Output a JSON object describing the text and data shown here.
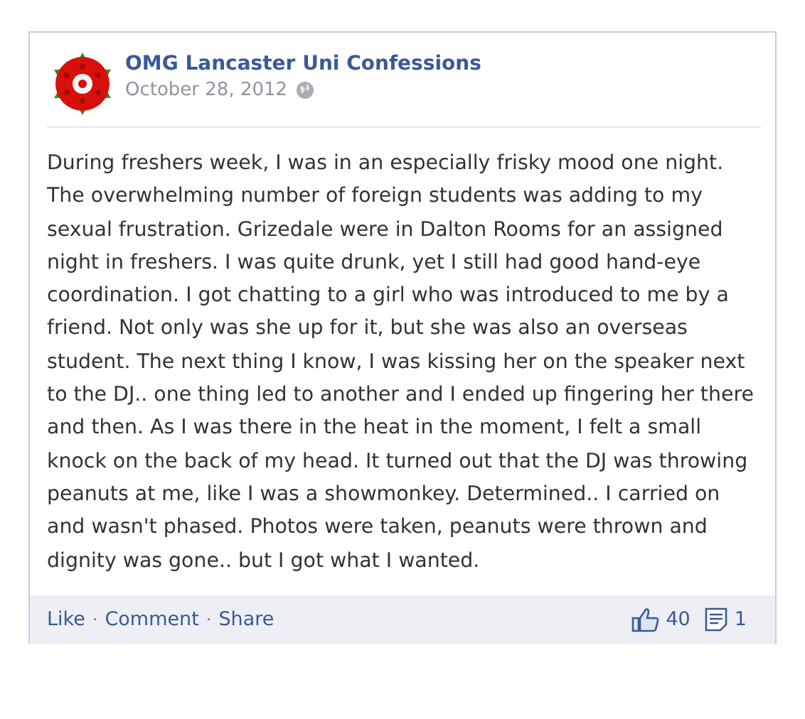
{
  "post": {
    "author": "OMG Lancaster Uni Confessions",
    "date": "October 28, 2012",
    "body": "During freshers week, I was in an especially frisky mood one night. The overwhelming number of foreign students was adding to my sexual frustration. Grizedale were in Dalton Rooms for an assigned night in freshers. I was quite drunk, yet I still had good hand-eye coordination. I got chatting to a girl who was introduced to me by a friend. Not only was she up for it, but she was also an overseas student. The next thing I know, I was kissing her on the speaker next to the DJ.. one thing led to another and I ended up fingering her there and then. As I was there in the heat in the moment, I felt a small knock on the back of my head. It turned out that the DJ was throwing peanuts at me, like I was a showmonkey. Determined.. I carried on and wasn't phased. Photos were taken, peanuts were thrown and dignity was gone.. but I got what I wanted."
  },
  "actions": [
    "Like",
    "Comment",
    "Share"
  ],
  "separator": "·",
  "likes": "40",
  "comments": "1"
}
